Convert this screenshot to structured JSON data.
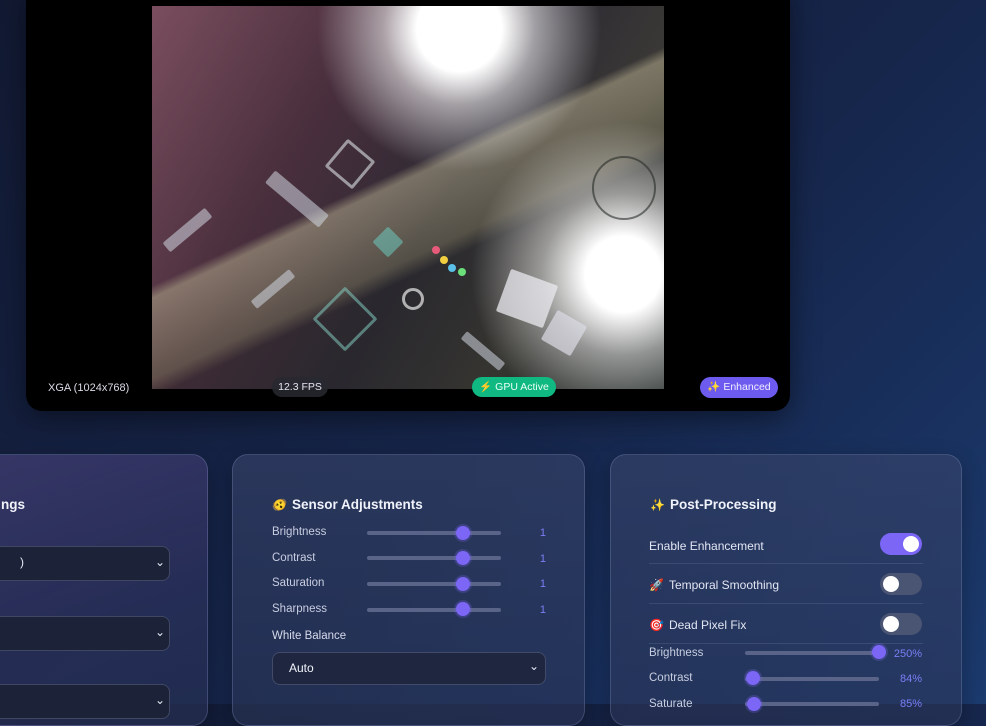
{
  "video": {
    "resolution_label": "XGA (1024x768)",
    "fps_label": "12.3 FPS",
    "gpu_label": "⚡ GPU Active",
    "enhanced_label": "✨ Enhanced"
  },
  "left_panel": {
    "title_fragment": "ngs",
    "select_1_value": ")"
  },
  "sensor": {
    "title": "Sensor Adjustments",
    "icon": "🫨",
    "sliders": [
      {
        "label": "Brightness",
        "value": "1",
        "position": 0.72
      },
      {
        "label": "Contrast",
        "value": "1",
        "position": 0.72
      },
      {
        "label": "Saturation",
        "value": "1",
        "position": 0.72
      },
      {
        "label": "Sharpness",
        "value": "1",
        "position": 0.72
      }
    ],
    "white_balance_label": "White Balance",
    "white_balance_value": "Auto"
  },
  "post": {
    "title": "Post-Processing",
    "icon": "✨",
    "toggles": [
      {
        "label": "Enable Enhancement",
        "icon": "",
        "on": true
      },
      {
        "label": "Temporal Smoothing",
        "icon": "🚀",
        "on": false
      },
      {
        "label": "Dead Pixel Fix",
        "icon": "🎯",
        "on": false
      }
    ],
    "sliders": [
      {
        "label": "Brightness",
        "value": "250%",
        "position": 1.0
      },
      {
        "label": "Contrast",
        "value": "84%",
        "position": 0.06
      },
      {
        "label": "Saturate",
        "value": "85%",
        "position": 0.07
      }
    ]
  },
  "colors": {
    "accent": "#7b66f5",
    "gpu_green": "#10b981",
    "enhanced_purple": "#6d5bf0"
  }
}
